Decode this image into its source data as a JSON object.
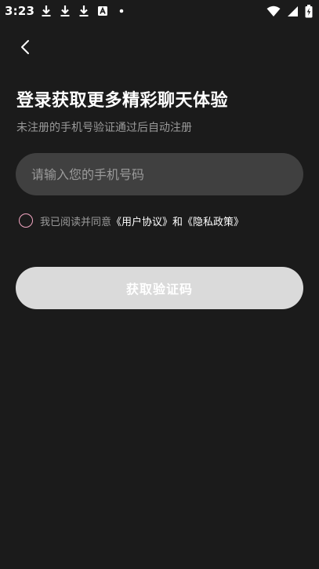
{
  "status_bar": {
    "time": "3:23",
    "left_icons": [
      "download-icon",
      "download-icon",
      "download-icon",
      "app-notification-icon",
      "dot-icon"
    ],
    "right_icons": [
      "wifi-icon",
      "signal-icon",
      "battery-icon"
    ]
  },
  "header": {
    "back_icon": "chevron-left-icon"
  },
  "login": {
    "title": "登录获取更多精彩聊天体验",
    "subtitle": "未注册的手机号验证通过后自动注册",
    "phone_placeholder": "请输入您的手机号码",
    "phone_value": "",
    "agreement_prefix": "我已阅读并同意",
    "user_agreement": "《用户协议》",
    "and_text": "和",
    "privacy_policy": "《隐私政策》",
    "agreed": false,
    "submit_label": "获取验证码"
  },
  "colors": {
    "background": "#1b1b1b",
    "input_bg": "#404040",
    "button_bg": "#dadada",
    "radio_border": "#f2a6c2",
    "muted_text": "#9a9a9a"
  }
}
